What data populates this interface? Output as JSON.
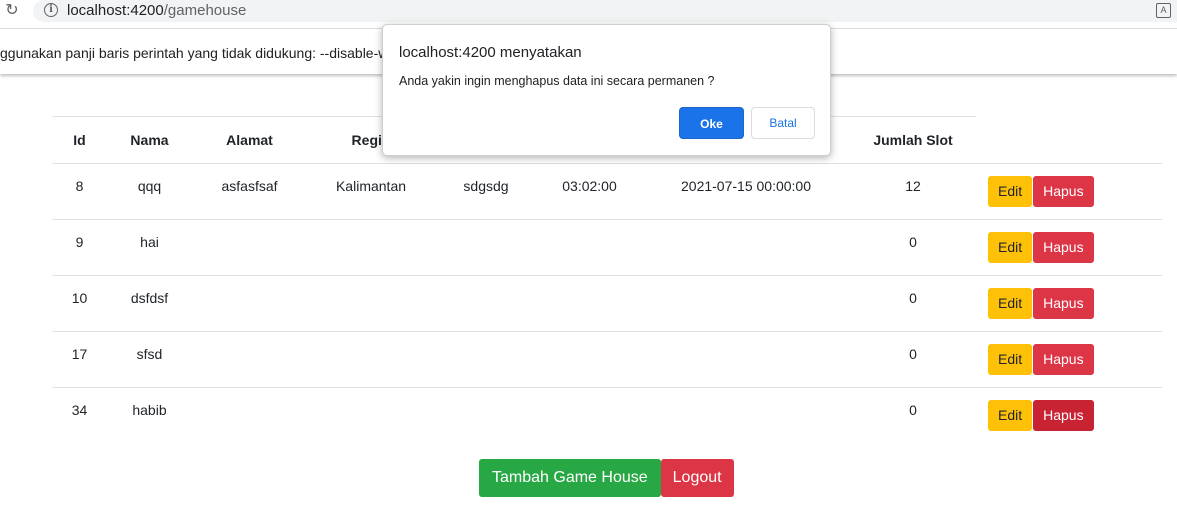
{
  "browser": {
    "url_host": "localhost:4200",
    "url_path": "/gamehouse",
    "infobar_text": "ggunakan panji baris perintah yang tidak didukung: --disable-web-"
  },
  "dialog": {
    "title": "localhost:4200 menyatakan",
    "message": "Anda yakin ingin menghapus data ini secara permanen ?",
    "ok_label": "Oke",
    "cancel_label": "Batal"
  },
  "table": {
    "headers": [
      "Id",
      "Nama",
      "Alamat",
      "Regio",
      "",
      "",
      "",
      "Jumlah Slot"
    ],
    "rows": [
      {
        "id": "8",
        "nama": "qqq",
        "alamat": "asfasfsaf",
        "region": "Kalimantan",
        "c5": "sdgsdg",
        "c6": "03:02:00",
        "c7": "2021-07-15 00:00:00",
        "slot": "12"
      },
      {
        "id": "9",
        "nama": "hai",
        "alamat": "",
        "region": "",
        "c5": "",
        "c6": "",
        "c7": "",
        "slot": "0"
      },
      {
        "id": "10",
        "nama": "dsfdsf",
        "alamat": "",
        "region": "",
        "c5": "",
        "c6": "",
        "c7": "",
        "slot": "0"
      },
      {
        "id": "17",
        "nama": "sfsd",
        "alamat": "",
        "region": "",
        "c5": "",
        "c6": "",
        "c7": "",
        "slot": "0"
      },
      {
        "id": "34",
        "nama": "habib",
        "alamat": "",
        "region": "",
        "c5": "",
        "c6": "",
        "c7": "",
        "slot": "0"
      }
    ],
    "edit_label": "Edit",
    "delete_label": "Hapus"
  },
  "actions": {
    "add_label": "Tambah Game House",
    "logout_label": "Logout"
  },
  "colors": {
    "edit": "#ffc107",
    "delete": "#dc3545",
    "add": "#28a745",
    "dialog_ok": "#1a73e8"
  }
}
